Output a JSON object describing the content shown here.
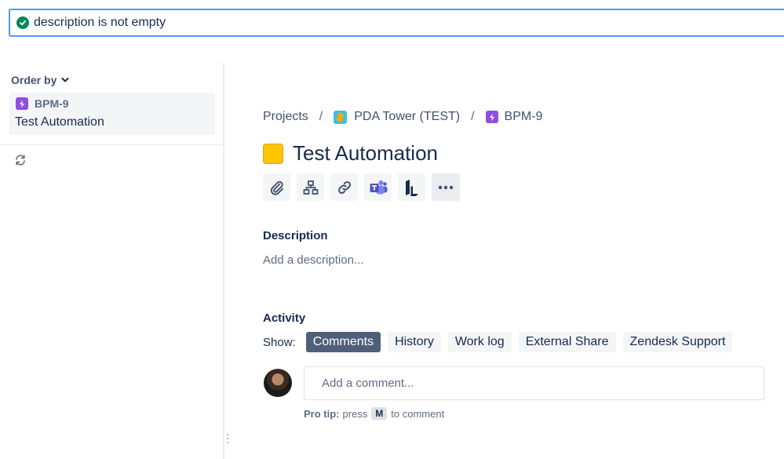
{
  "search": {
    "jql_status": "description is not empty"
  },
  "sidebar": {
    "order_by_label": "Order by",
    "issues": [
      {
        "key": "BPM-9",
        "summary": "Test Automation"
      }
    ]
  },
  "breadcrumb": {
    "projects": "Projects",
    "project_name": "PDA Tower (TEST)",
    "issue_key": "BPM-9",
    "separator": "/"
  },
  "issue": {
    "title": "Test Automation",
    "status_color": "#ffc400"
  },
  "toolbar": {
    "icons": [
      "paperclip-icon",
      "hierarchy-icon",
      "link-icon",
      "teams-icon",
      "l-logo-icon",
      "more-icon"
    ]
  },
  "description": {
    "heading": "Description",
    "placeholder": "Add a description..."
  },
  "activity": {
    "heading": "Activity",
    "show_label": "Show:",
    "tabs": [
      {
        "label": "Comments",
        "active": true
      },
      {
        "label": "History",
        "active": false
      },
      {
        "label": "Work log",
        "active": false
      },
      {
        "label": "External Share",
        "active": false
      },
      {
        "label": "Zendesk Support",
        "active": false
      }
    ],
    "comment_placeholder": "Add a comment...",
    "pro_tip_label": "Pro tip:",
    "pro_tip_press": "press",
    "pro_tip_key": "M",
    "pro_tip_suffix": "to comment"
  },
  "colors": {
    "accent": "#4c9aff",
    "active_tab": "#505f79",
    "story_purple": "#904ee2",
    "success": "#00875a"
  }
}
